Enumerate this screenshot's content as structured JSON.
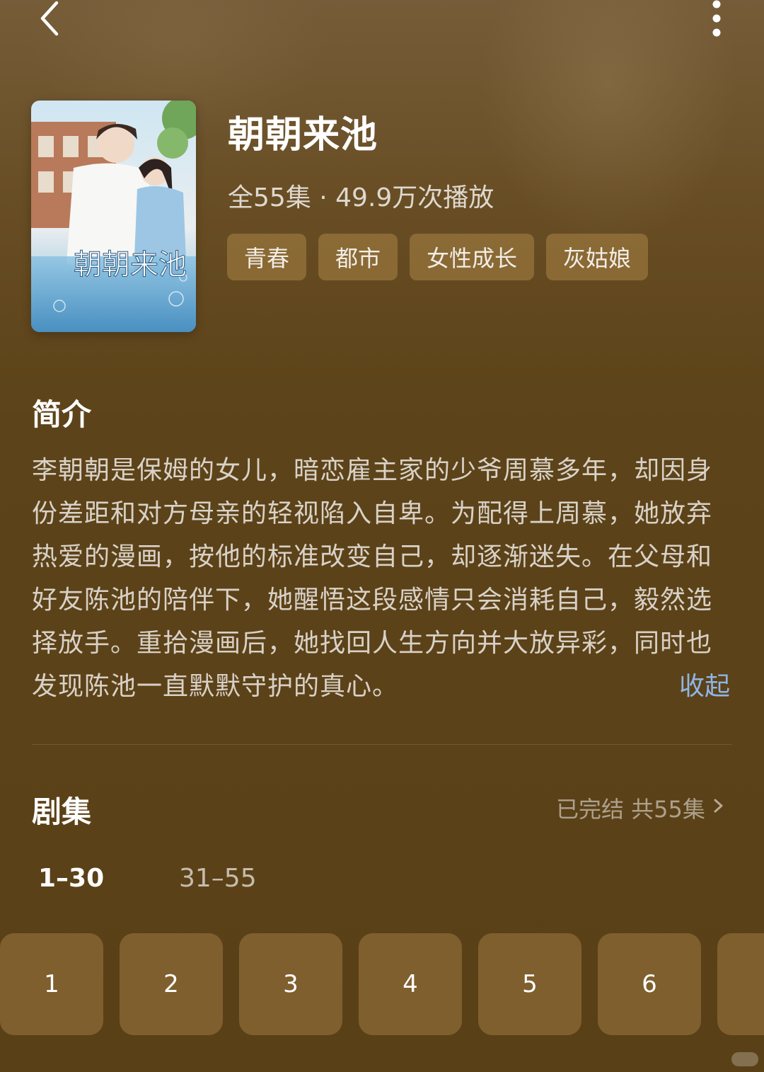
{
  "header": {
    "back_icon": "chevron-left-icon",
    "more_icon": "more-vertical-icon"
  },
  "drama": {
    "cover_title": "朝朝来池",
    "title": "朝朝来池",
    "meta": "全55集 · 49.9万次播放",
    "tags": [
      "青春",
      "都市",
      "女性成长",
      "灰姑娘"
    ]
  },
  "synopsis": {
    "heading": "简介",
    "text": "李朝朝是保姆的女儿，暗恋雇主家的少爷周慕多年，却因身份差距和对方母亲的轻视陷入自卑。为配得上周慕，她放弃热爱的漫画，按他的标准改变自己，却逐渐迷失。在父母和好友陈池的陪伴下，她醒悟这段感情只会消耗自己，毅然选择放手。重拾漫画后，她找回人生方向并大放异彩，同时也发现陈池一直默默守护的真心。",
    "collapse_label": "收起"
  },
  "episodes": {
    "heading": "剧集",
    "status": "已完结 共55集",
    "ranges": [
      "1–30",
      "31–55"
    ],
    "active_range": "1–30",
    "items": [
      "1",
      "2",
      "3",
      "4",
      "5",
      "6"
    ]
  },
  "colors": {
    "background": "#5d4319",
    "tag_bg": "#8c6a32",
    "link": "#8fb6e8"
  }
}
